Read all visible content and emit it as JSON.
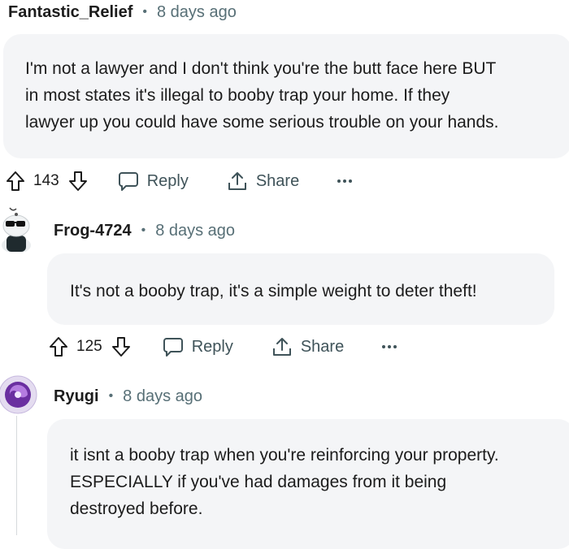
{
  "comments": [
    {
      "username": "Fantastic_Relief",
      "timestamp": "8 days ago",
      "separator": "•",
      "body_lines": [
        "I'm not a lawyer and I don't think you're the butt face here BUT",
        "in most states it's illegal to booby trap your home. If they",
        "lawyer up you could have some serious trouble on your hands."
      ],
      "votes": "143",
      "reply_label": "Reply",
      "share_label": "Share",
      "more_label": "•••"
    },
    {
      "username": "Frog-4724",
      "timestamp": "8 days ago",
      "separator": "•",
      "body_lines": [
        "It's not a booby trap, it's a simple weight to deter theft!"
      ],
      "votes": "125",
      "reply_label": "Reply",
      "share_label": "Share",
      "more_label": "•••"
    },
    {
      "username": "Ryugi",
      "timestamp": "8 days ago",
      "separator": "•",
      "body_lines": [
        "it isnt a booby trap when you're reinforcing your property.",
        "ESPECIALLY if you've had damages from it being",
        "destroyed before."
      ]
    }
  ],
  "icons": {
    "upvote": "upvote-arrow-icon",
    "downvote": "downvote-arrow-icon",
    "reply": "speech-bubble-icon",
    "share": "share-upload-icon",
    "more": "ellipsis-icon"
  },
  "colors": {
    "bubble_bg": "#f4f5f7",
    "meta_text": "#576f76",
    "ryugi_avatar": "#6a2fa0"
  }
}
